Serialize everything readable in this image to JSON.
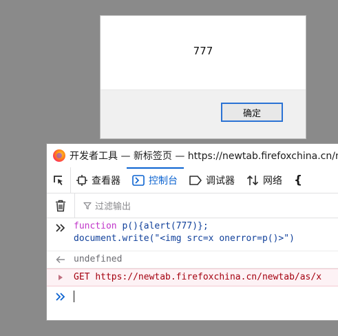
{
  "alert": {
    "message": "777",
    "ok_label": "确定"
  },
  "devtools": {
    "window_title": "开发者工具 — 新标签页 — https://newtab.firefoxchina.cn/newtab/as/x",
    "tabs": [
      {
        "label": "查看器",
        "icon": "inspector-icon"
      },
      {
        "label": "控制台",
        "icon": "console-icon",
        "active": true
      },
      {
        "label": "调试器",
        "icon": "debugger-icon"
      },
      {
        "label": "网络",
        "icon": "network-icon"
      }
    ],
    "more_tabs_glyph": "{",
    "filter_placeholder": "过滤输出",
    "console": {
      "input_line1_kw": "function",
      "input_line1_rest": " p(){alert(777)};",
      "input_line2_plain": "document.write(",
      "input_line2_str": "\"<img src=x onerror=p()>\"",
      "input_line2_end": ")",
      "result": "undefined",
      "error_method": "GET",
      "error_url": "https://newtab.firefoxchina.cn/newtab/as/x"
    }
  },
  "colors": {
    "accent": "#0a62d0",
    "error_bg": "#fdf2f5",
    "error_text": "#a4000f",
    "keyword": "#c035c9"
  }
}
